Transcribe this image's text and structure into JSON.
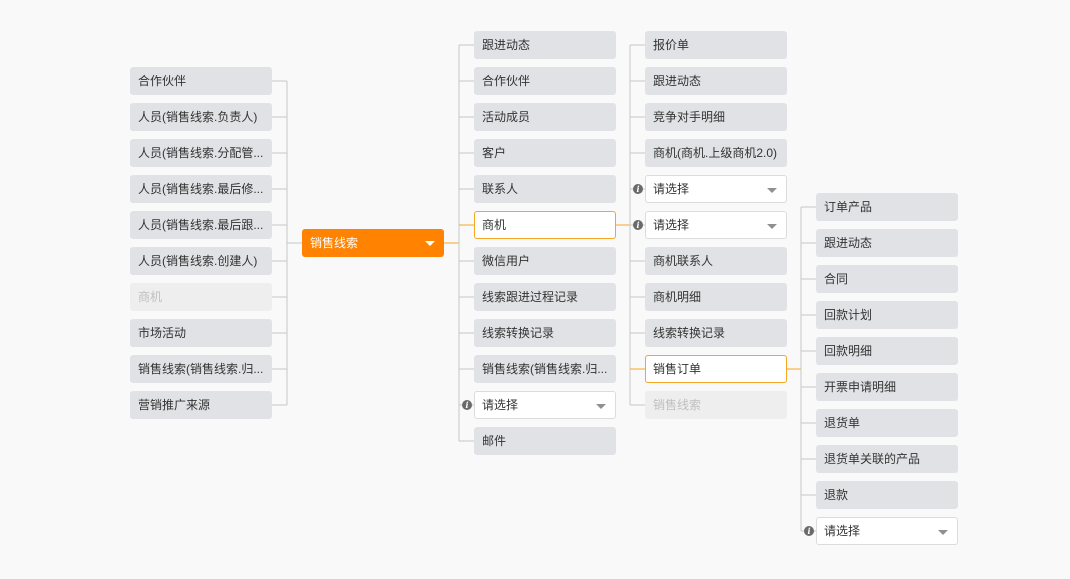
{
  "root": {
    "label": "销售线索"
  },
  "left_nodes": [
    {
      "label": "合作伙伴"
    },
    {
      "label": "人员(销售线索.负责人)"
    },
    {
      "label": "人员(销售线索.分配管..."
    },
    {
      "label": "人员(销售线索.最后修..."
    },
    {
      "label": "人员(销售线索.最后跟..."
    },
    {
      "label": "人员(销售线索.创建人)"
    },
    {
      "label": "商机",
      "disabled": true
    },
    {
      "label": "市场活动"
    },
    {
      "label": "销售线索(销售线索.归..."
    },
    {
      "label": "营销推广来源"
    }
  ],
  "col2_nodes": [
    {
      "label": "跟进动态"
    },
    {
      "label": "合作伙伴"
    },
    {
      "label": "活动成员"
    },
    {
      "label": "客户"
    },
    {
      "label": "联系人"
    },
    {
      "label": "商机",
      "selected": true
    },
    {
      "label": "微信用户"
    },
    {
      "label": "线索跟进过程记录"
    },
    {
      "label": "线索转换记录"
    },
    {
      "label": "销售线索(销售线索.归..."
    },
    {
      "label": "请选择",
      "select": true
    },
    {
      "label": "邮件"
    }
  ],
  "col3_nodes": [
    {
      "label": "报价单"
    },
    {
      "label": "跟进动态"
    },
    {
      "label": "竞争对手明细"
    },
    {
      "label": "商机(商机.上级商机2.0)"
    },
    {
      "label": "请选择",
      "select": true
    },
    {
      "label": "请选择",
      "select": true
    },
    {
      "label": "商机联系人"
    },
    {
      "label": "商机明细"
    },
    {
      "label": "线索转换记录"
    },
    {
      "label": "销售订单",
      "selected": true
    },
    {
      "label": "销售线索",
      "disabled": true
    }
  ],
  "col4_nodes": [
    {
      "label": "订单产品"
    },
    {
      "label": "跟进动态"
    },
    {
      "label": "合同"
    },
    {
      "label": "回款计划"
    },
    {
      "label": "回款明细"
    },
    {
      "label": "开票申请明细"
    },
    {
      "label": "退货单"
    },
    {
      "label": "退货单关联的产品"
    },
    {
      "label": "退款"
    },
    {
      "label": "请选择",
      "select": true
    }
  ],
  "colors": {
    "accent": "#ff8200",
    "line_active": "#f5a623",
    "line": "#c8c8c8",
    "node_bg": "#e1e2e6"
  }
}
